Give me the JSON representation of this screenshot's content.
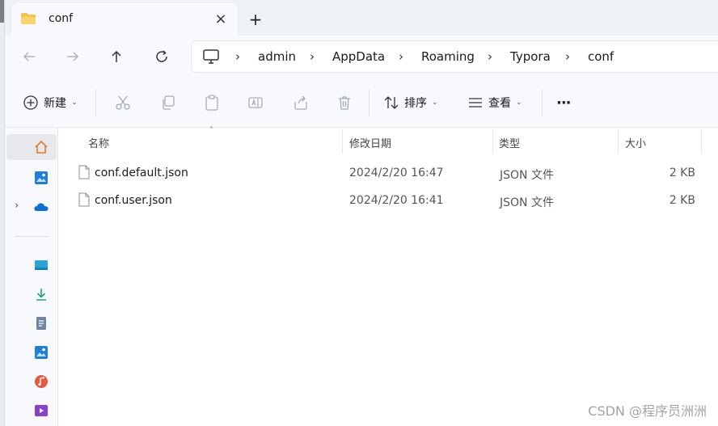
{
  "tab": {
    "title": "conf",
    "close_glyph": "×",
    "new_tab_glyph": "+"
  },
  "address": {
    "breadcrumbs": [
      "admin",
      "AppData",
      "Roaming",
      "Typora",
      "conf"
    ]
  },
  "toolbar": {
    "new_label": "新建",
    "sort_label": "排序",
    "view_label": "查看",
    "more_glyph": "···"
  },
  "columns": {
    "name": "名称",
    "modified": "修改日期",
    "type": "类型",
    "size": "大小"
  },
  "files": [
    {
      "name": "conf.default.json",
      "modified": "2024/2/20 16:47",
      "type": "JSON 文件",
      "size": "2 KB"
    },
    {
      "name": "conf.user.json",
      "modified": "2024/2/20 16:41",
      "type": "JSON 文件",
      "size": "2 KB"
    }
  ],
  "watermark": "CSDN @程序员洲洲",
  "colors": {
    "folder": "#f2c24b",
    "accent": "#0067c0",
    "onedrive": "#0a6fd6"
  }
}
